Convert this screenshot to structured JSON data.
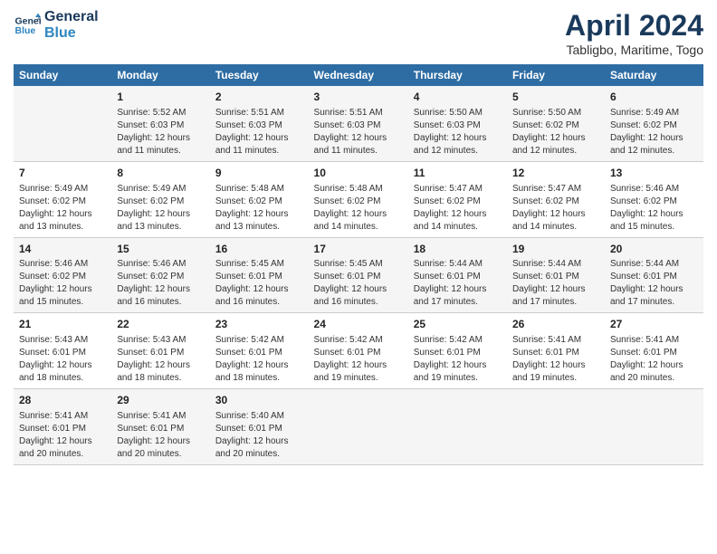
{
  "header": {
    "logo_line1": "General",
    "logo_line2": "Blue",
    "month": "April 2024",
    "location": "Tabligbo, Maritime, Togo"
  },
  "columns": [
    "Sunday",
    "Monday",
    "Tuesday",
    "Wednesday",
    "Thursday",
    "Friday",
    "Saturday"
  ],
  "weeks": [
    [
      {
        "day": "",
        "info": ""
      },
      {
        "day": "1",
        "info": "Sunrise: 5:52 AM\nSunset: 6:03 PM\nDaylight: 12 hours\nand 11 minutes."
      },
      {
        "day": "2",
        "info": "Sunrise: 5:51 AM\nSunset: 6:03 PM\nDaylight: 12 hours\nand 11 minutes."
      },
      {
        "day": "3",
        "info": "Sunrise: 5:51 AM\nSunset: 6:03 PM\nDaylight: 12 hours\nand 11 minutes."
      },
      {
        "day": "4",
        "info": "Sunrise: 5:50 AM\nSunset: 6:03 PM\nDaylight: 12 hours\nand 12 minutes."
      },
      {
        "day": "5",
        "info": "Sunrise: 5:50 AM\nSunset: 6:02 PM\nDaylight: 12 hours\nand 12 minutes."
      },
      {
        "day": "6",
        "info": "Sunrise: 5:49 AM\nSunset: 6:02 PM\nDaylight: 12 hours\nand 12 minutes."
      }
    ],
    [
      {
        "day": "7",
        "info": "Sunrise: 5:49 AM\nSunset: 6:02 PM\nDaylight: 12 hours\nand 13 minutes."
      },
      {
        "day": "8",
        "info": "Sunrise: 5:49 AM\nSunset: 6:02 PM\nDaylight: 12 hours\nand 13 minutes."
      },
      {
        "day": "9",
        "info": "Sunrise: 5:48 AM\nSunset: 6:02 PM\nDaylight: 12 hours\nand 13 minutes."
      },
      {
        "day": "10",
        "info": "Sunrise: 5:48 AM\nSunset: 6:02 PM\nDaylight: 12 hours\nand 14 minutes."
      },
      {
        "day": "11",
        "info": "Sunrise: 5:47 AM\nSunset: 6:02 PM\nDaylight: 12 hours\nand 14 minutes."
      },
      {
        "day": "12",
        "info": "Sunrise: 5:47 AM\nSunset: 6:02 PM\nDaylight: 12 hours\nand 14 minutes."
      },
      {
        "day": "13",
        "info": "Sunrise: 5:46 AM\nSunset: 6:02 PM\nDaylight: 12 hours\nand 15 minutes."
      }
    ],
    [
      {
        "day": "14",
        "info": "Sunrise: 5:46 AM\nSunset: 6:02 PM\nDaylight: 12 hours\nand 15 minutes."
      },
      {
        "day": "15",
        "info": "Sunrise: 5:46 AM\nSunset: 6:02 PM\nDaylight: 12 hours\nand 16 minutes."
      },
      {
        "day": "16",
        "info": "Sunrise: 5:45 AM\nSunset: 6:01 PM\nDaylight: 12 hours\nand 16 minutes."
      },
      {
        "day": "17",
        "info": "Sunrise: 5:45 AM\nSunset: 6:01 PM\nDaylight: 12 hours\nand 16 minutes."
      },
      {
        "day": "18",
        "info": "Sunrise: 5:44 AM\nSunset: 6:01 PM\nDaylight: 12 hours\nand 17 minutes."
      },
      {
        "day": "19",
        "info": "Sunrise: 5:44 AM\nSunset: 6:01 PM\nDaylight: 12 hours\nand 17 minutes."
      },
      {
        "day": "20",
        "info": "Sunrise: 5:44 AM\nSunset: 6:01 PM\nDaylight: 12 hours\nand 17 minutes."
      }
    ],
    [
      {
        "day": "21",
        "info": "Sunrise: 5:43 AM\nSunset: 6:01 PM\nDaylight: 12 hours\nand 18 minutes."
      },
      {
        "day": "22",
        "info": "Sunrise: 5:43 AM\nSunset: 6:01 PM\nDaylight: 12 hours\nand 18 minutes."
      },
      {
        "day": "23",
        "info": "Sunrise: 5:42 AM\nSunset: 6:01 PM\nDaylight: 12 hours\nand 18 minutes."
      },
      {
        "day": "24",
        "info": "Sunrise: 5:42 AM\nSunset: 6:01 PM\nDaylight: 12 hours\nand 19 minutes."
      },
      {
        "day": "25",
        "info": "Sunrise: 5:42 AM\nSunset: 6:01 PM\nDaylight: 12 hours\nand 19 minutes."
      },
      {
        "day": "26",
        "info": "Sunrise: 5:41 AM\nSunset: 6:01 PM\nDaylight: 12 hours\nand 19 minutes."
      },
      {
        "day": "27",
        "info": "Sunrise: 5:41 AM\nSunset: 6:01 PM\nDaylight: 12 hours\nand 20 minutes."
      }
    ],
    [
      {
        "day": "28",
        "info": "Sunrise: 5:41 AM\nSunset: 6:01 PM\nDaylight: 12 hours\nand 20 minutes."
      },
      {
        "day": "29",
        "info": "Sunrise: 5:41 AM\nSunset: 6:01 PM\nDaylight: 12 hours\nand 20 minutes."
      },
      {
        "day": "30",
        "info": "Sunrise: 5:40 AM\nSunset: 6:01 PM\nDaylight: 12 hours\nand 20 minutes."
      },
      {
        "day": "",
        "info": ""
      },
      {
        "day": "",
        "info": ""
      },
      {
        "day": "",
        "info": ""
      },
      {
        "day": "",
        "info": ""
      }
    ]
  ]
}
